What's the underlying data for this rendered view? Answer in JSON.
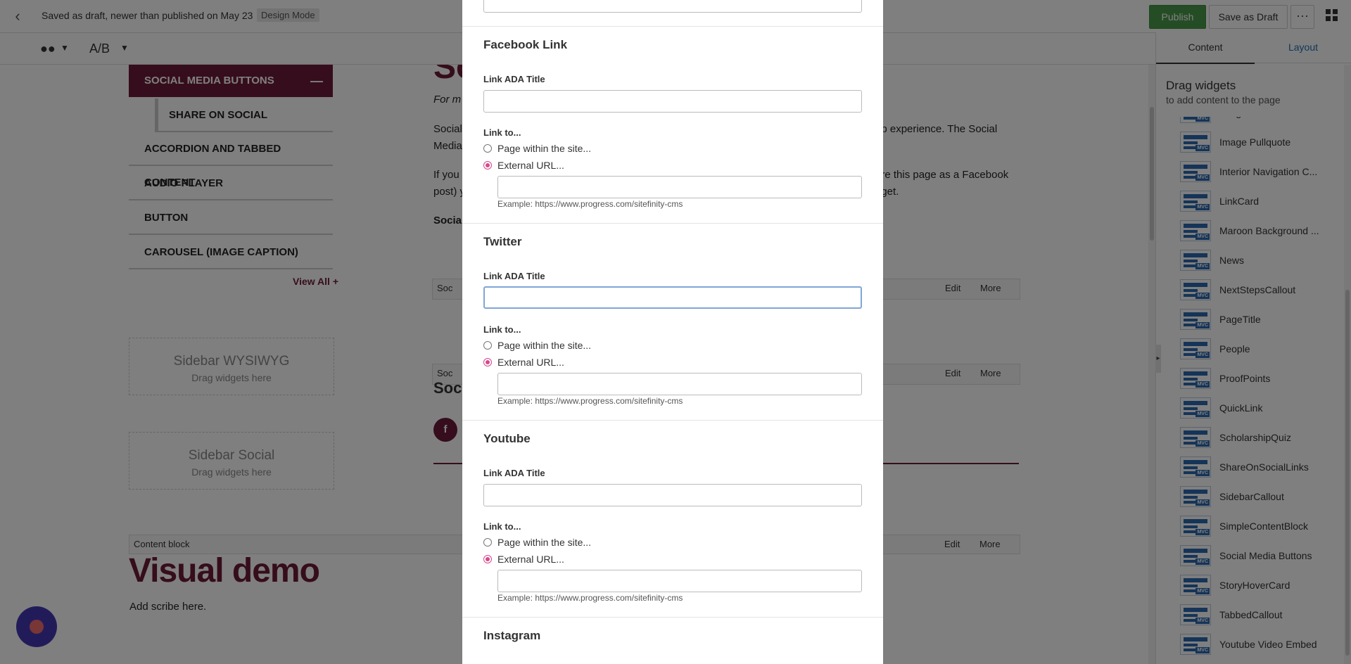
{
  "topbar": {
    "status": "Saved as draft, newer than published on May 23",
    "mode_badge": "Design Mode",
    "publish": "Publish",
    "save_draft": "Save as Draft",
    "more": "···"
  },
  "toolbar2": {
    "ab": "A/B"
  },
  "canvas": {
    "heading_fragment": "So",
    "nav": {
      "active": "SOCIAL MEDIA BUTTONS",
      "sub": "SHARE ON SOCIAL",
      "items": [
        "ACCORDION AND TABBED CONTENT",
        "AUDIO PLAYER",
        "BUTTON",
        "CAROUSEL (IMAGE CAPTION)"
      ],
      "view_all": "View All"
    },
    "drop_zones": [
      {
        "title": "Sidebar WYSIWYG",
        "sub": "Drag widgets here"
      },
      {
        "title": "Sidebar Social",
        "sub": "Drag widgets here"
      }
    ],
    "paragraphs": [
      {
        "left": "For m",
        "right": ""
      },
      {
        "left": "Social",
        "right": "eb experience. The Social"
      },
      {
        "left": "Media",
        "right": ""
      },
      {
        "left": "If you",
        "right": "are this page as a Facebook"
      },
      {
        "left": "post) y",
        "right": "dget."
      },
      {
        "left": "Social",
        "right": ""
      }
    ],
    "widget_bars": [
      {
        "label": "Soc",
        "edit": "Edit",
        "more": "More"
      },
      {
        "label": "Soc",
        "edit": "Edit",
        "more": "More"
      }
    ],
    "social_heading_frag": "Soci",
    "fb_letter": "f",
    "content_block": {
      "label": "Content block",
      "edit": "Edit",
      "more": "More"
    },
    "visual_demo": "Visual demo",
    "add_scribe": "Add scribe here."
  },
  "right_panel": {
    "tabs": {
      "content": "Content",
      "layout": "Layout"
    },
    "drag_title": "Drag widgets",
    "drag_sub": "to add content to the page",
    "widgets": [
      "Image Card Callout",
      "Image Pullquote",
      "Interior Navigation C...",
      "LinkCard",
      "Maroon Background ...",
      "News",
      "NextStepsCallout",
      "PageTitle",
      "People",
      "ProofPoints",
      "QuickLink",
      "ScholarshipQuiz",
      "ShareOnSocialLinks",
      "SidebarCallout",
      "SimpleContentBlock",
      "Social Media Buttons",
      "StoryHoverCard",
      "TabbedCallout",
      "Youtube Video Embed"
    ],
    "mvc_tag": "MVC"
  },
  "modal": {
    "sections": [
      {
        "title": "Facebook Link",
        "ada_label": "Link ADA Title",
        "ada_value": "",
        "link_to": "Link to...",
        "opt_page": "Page within the site...",
        "opt_external": "External URL...",
        "url_value": "",
        "example": "Example: https://www.progress.com/sitefinity-cms"
      },
      {
        "title": "Twitter",
        "ada_label": "Link ADA Title",
        "ada_value": "",
        "link_to": "Link to...",
        "opt_page": "Page within the site...",
        "opt_external": "External URL...",
        "url_value": "",
        "example": "Example: https://www.progress.com/sitefinity-cms"
      },
      {
        "title": "Youtube",
        "ada_label": "Link ADA Title",
        "ada_value": "",
        "link_to": "Link to...",
        "opt_page": "Page within the site...",
        "opt_external": "External URL...",
        "url_value": "",
        "example": "Example: https://www.progress.com/sitefinity-cms"
      }
    ],
    "next_section_title": "Instagram"
  },
  "colors": {
    "brand_maroon": "#6d1a38",
    "publish_green": "#4a9b4a",
    "link_blue": "#1f6fb4",
    "radio_pink": "#d9478a",
    "fab_purple": "#4239b3"
  }
}
